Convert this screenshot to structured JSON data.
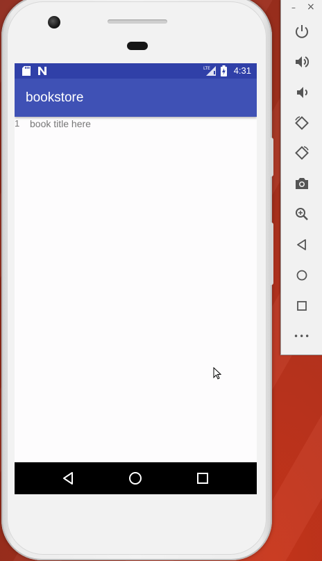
{
  "app": {
    "title": "bookstore"
  },
  "status_bar": {
    "time": "4:31",
    "icons": [
      "sd-card-icon",
      "n-notification-icon",
      "lte-signal-icon",
      "battery-charging-icon"
    ],
    "network_label": "LTE"
  },
  "book_list": {
    "items": [
      {
        "number": "1",
        "title": "book title here"
      }
    ]
  },
  "nav_bar": {
    "buttons": [
      "back-icon",
      "home-icon",
      "recents-icon"
    ]
  },
  "emulator_panel": {
    "window_controls": {
      "minimize": "–",
      "close": "×"
    },
    "buttons": [
      "power-icon",
      "volume-up-icon",
      "volume-down-icon",
      "rotate-left-icon",
      "rotate-right-icon",
      "camera-icon",
      "zoom-icon",
      "back-icon",
      "home-icon",
      "overview-icon",
      "more-icon"
    ],
    "more_label": "•••"
  },
  "colors": {
    "status_bar": "#3040a8",
    "app_bar": "#3f51b5",
    "nav_bar": "#000000",
    "list_text": "#777777",
    "wallpaper": "#b8331e"
  }
}
